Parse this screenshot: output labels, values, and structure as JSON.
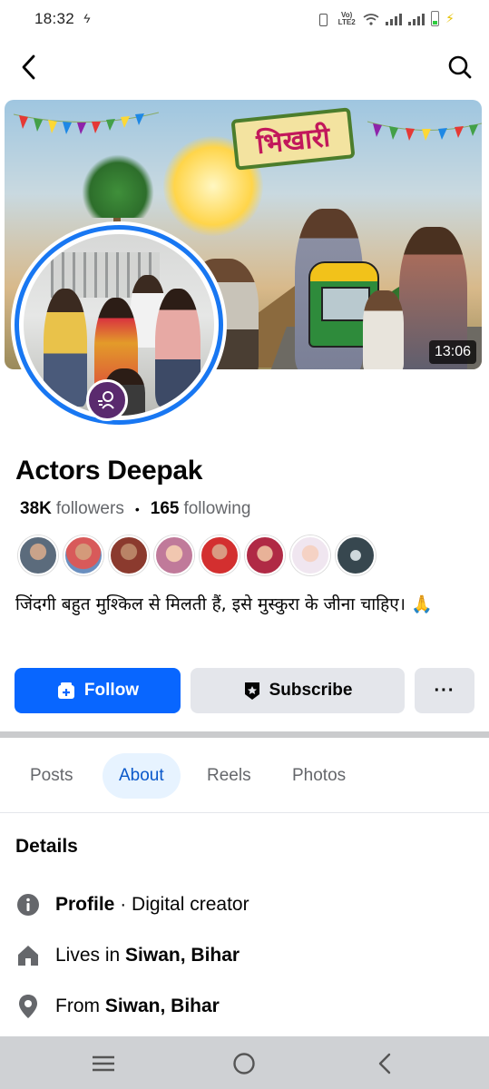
{
  "status_bar": {
    "time": "18:32",
    "network_label": "Vo) LTE2"
  },
  "header": {
    "back_icon": "chevron-left-icon",
    "search_icon": "search-icon"
  },
  "cover": {
    "title_text": "भिखारी",
    "duration": "13:06"
  },
  "profile": {
    "name": "Actors Deepak",
    "followers_count": "38K",
    "followers_label": "followers",
    "following_count": "165",
    "following_label": "following",
    "bio": "जिंदगी बहुत मुश्किल से मिलती हैं, इसे मुस्कुरा के जीना चाहिए। 🙏",
    "friend_avatar_count": 8
  },
  "actions": {
    "follow_label": "Follow",
    "subscribe_label": "Subscribe",
    "more_label": "···"
  },
  "tabs": [
    {
      "label": "Posts",
      "active": false
    },
    {
      "label": "About",
      "active": true
    },
    {
      "label": "Reels",
      "active": false
    },
    {
      "label": "Photos",
      "active": false
    }
  ],
  "details": {
    "title": "Details",
    "profile": {
      "label": "Profile",
      "sep": " · ",
      "value": "Digital creator"
    },
    "lives": {
      "prefix": "Lives in ",
      "value": "Siwan, Bihar"
    },
    "from": {
      "prefix": "From ",
      "value": "Siwan, Bihar"
    }
  },
  "colors": {
    "accent": "#0866ff",
    "active_tab_bg": "#e7f3ff",
    "active_tab_text": "#0a58ca",
    "avatar_ring": "#1877f2"
  }
}
